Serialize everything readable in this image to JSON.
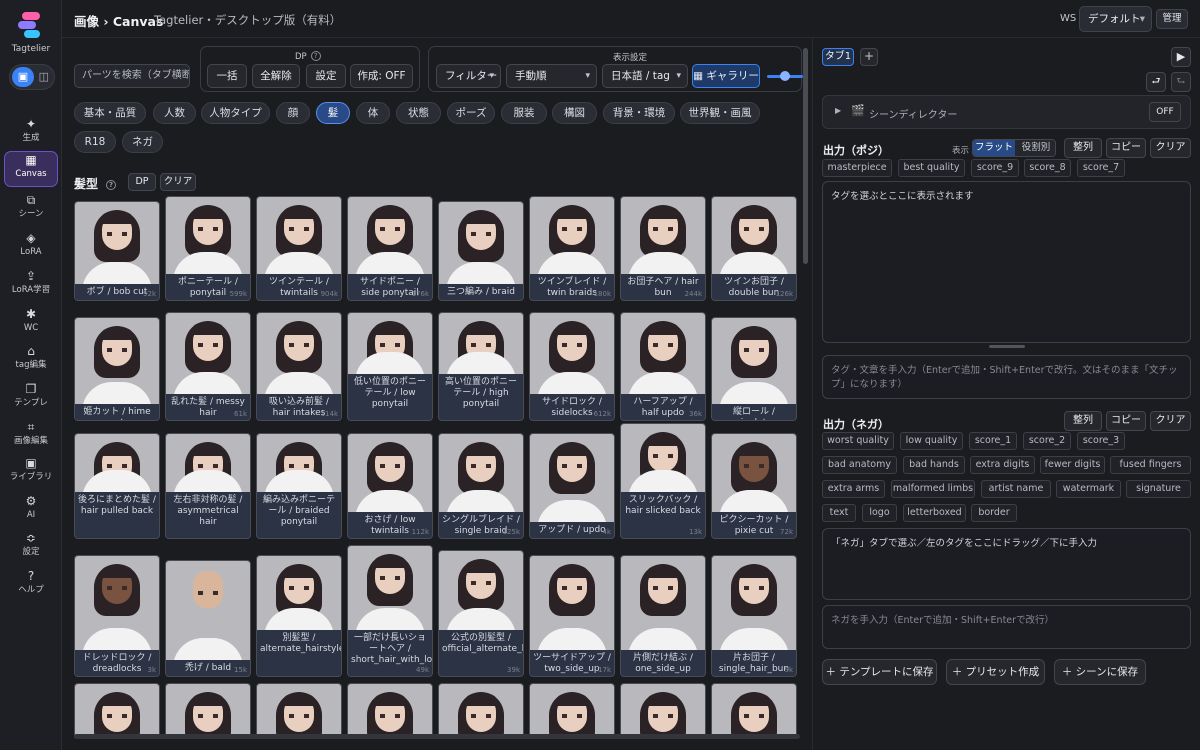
{
  "app": {
    "name": "Tagtelier"
  },
  "header": {
    "breadcrumb": "画像 › Canvas",
    "subtitle": "Tagtelier・デスクトップ版（有料）",
    "ws_label": "WS",
    "ws_value": "デフォルト",
    "admin": "管理"
  },
  "sidebar": {
    "items": [
      {
        "label": "生成",
        "icon": "✦"
      },
      {
        "label": "Canvas",
        "icon": "▦"
      },
      {
        "label": "シーン",
        "icon": "⧉"
      },
      {
        "label": "LoRA",
        "icon": "◈"
      },
      {
        "label": "LoRA学習",
        "icon": "⇪"
      },
      {
        "label": "WC",
        "icon": "✱"
      },
      {
        "label": "tag編集",
        "icon": "⌂"
      },
      {
        "label": "テンプレ",
        "icon": "❐"
      },
      {
        "label": "画像編集",
        "icon": "⌗"
      },
      {
        "label": "ライブラリ",
        "icon": "▣"
      },
      {
        "label": "AI",
        "icon": "⚙"
      },
      {
        "label": "設定",
        "icon": "≎"
      },
      {
        "label": "ヘルプ",
        "icon": "?"
      }
    ]
  },
  "toolbar": {
    "search_placeholder": "パーツを検索（タブ横断）",
    "dp": {
      "title": "DP",
      "help": "?",
      "all": "一括",
      "clear_all": "全解除",
      "settings": "設定",
      "create": "作成: OFF"
    },
    "display": {
      "title": "表示設定",
      "filter": "フィルター",
      "sort": "手動順",
      "lang": "日本語 / tag",
      "gallery": "ギャラリー"
    }
  },
  "categories": [
    "基本・品質",
    "人数",
    "人物タイプ",
    "顔",
    "髪",
    "体",
    "状態",
    "ポーズ",
    "服装",
    "構図",
    "背景・環境",
    "世界観・画風",
    "R18",
    "ネガ"
  ],
  "section": {
    "title": "髪型",
    "help": "?",
    "dp": "DP",
    "clear": "クリア"
  },
  "cards": [
    {
      "label": "ボブ / bob cut",
      "count": "92k"
    },
    {
      "label": "ポニーテール / ponytail",
      "count": "599k"
    },
    {
      "label": "ツインテール / twintails",
      "count": "904k"
    },
    {
      "label": "サイドポニー / side ponytail",
      "count": "176k"
    },
    {
      "label": "三つ編み / braid",
      "count": ""
    },
    {
      "label": "ツインブレイド / twin braids",
      "count": "180k"
    },
    {
      "label": "お団子ヘア / hair bun",
      "count": "244k"
    },
    {
      "label": "ツインお団子 / double bun",
      "count": "126k"
    },
    {
      "label": "姫カット / hime cut",
      "count": ""
    },
    {
      "label": "乱れた髪 / messy hair",
      "count": "61k"
    },
    {
      "label": "吸い込み前髪 / hair intakes",
      "count": "114k"
    },
    {
      "label": "低い位置のポニーテール / low ponytail",
      "count": ""
    },
    {
      "label": "高い位置のポニーテール / high ponytail",
      "count": ""
    },
    {
      "label": "サイドロック / sidelocks",
      "count": "612k"
    },
    {
      "label": "ハーフアップ / half updo",
      "count": "36k"
    },
    {
      "label": "縦ロール / ringlets",
      "count": ""
    },
    {
      "label": "後ろにまとめた髪 / hair pulled back",
      "count": ""
    },
    {
      "label": "左右非対称の髪 / asymmetrical hair",
      "count": ""
    },
    {
      "label": "編み込みポニーテール / braided ponytail",
      "count": ""
    },
    {
      "label": "おさげ / low twintails",
      "count": "112k"
    },
    {
      "label": "シングルブレイド / single braid",
      "count": "125k"
    },
    {
      "label": "アップド / updo",
      "count": "4k"
    },
    {
      "label": "スリックバック / hair slicked back",
      "count": "13k"
    },
    {
      "label": "ピクシーカット / pixie cut",
      "count": "72k"
    },
    {
      "label": "ドレッドロック / dreadlocks",
      "count": "3k"
    },
    {
      "label": "禿げ / bald",
      "count": "15k"
    },
    {
      "label": "別髪型 / alternate_hairstyle",
      "count": ""
    },
    {
      "label": "一部だけ長いショートヘア / short_hair_with_long_locks",
      "count": "49k"
    },
    {
      "label": "公式の別髪型 / official_alternate_hairstyle",
      "count": "39k"
    },
    {
      "label": "ツーサイドアップ / two_side_up",
      "count": "17k"
    },
    {
      "label": "片側だけ結ぶ / one_side_up",
      "count": ""
    },
    {
      "label": "片お団子 / single_hair_bun",
      "count": "9k"
    }
  ],
  "right": {
    "tab1": "タブ1",
    "add": "+",
    "director": {
      "label": "シーンディレクター",
      "state": "OFF"
    },
    "positive": {
      "title": "出力（ポジ）",
      "display_label": "表示",
      "flat": "フラット",
      "by_role": "役割別",
      "sort": "整列",
      "copy": "コピー",
      "clear": "クリア",
      "tags": [
        "masterpiece",
        "best quality",
        "score_9",
        "score_8",
        "score_7"
      ],
      "area_text": "タグを選ぶとここに表示されます",
      "input_placeholder": "タグ・文章を手入力（Enterで追加・Shift+Enterで改行。文はそのまま「文チップ」になります）"
    },
    "negative": {
      "title": "出力（ネガ）",
      "sort": "整列",
      "copy": "コピー",
      "clear": "クリア",
      "tags": [
        "worst quality",
        "low quality",
        "score_1",
        "score_2",
        "score_3",
        "bad anatomy",
        "bad hands",
        "extra digits",
        "fewer digits",
        "fused fingers",
        "extra arms",
        "malformed limbs",
        "artist name",
        "watermark",
        "signature",
        "text",
        "logo",
        "letterboxed",
        "border"
      ],
      "area_text": "「ネガ」タブで選ぶ／左のタグをここにドラッグ／下に手入力",
      "input_placeholder": "ネガを手入力（Enterで追加・Shift+Enterで改行）"
    },
    "save_template": "＋ テンプレートに保存",
    "create_preset": "＋ プリセット作成",
    "save_scene": "＋ シーンに保存"
  }
}
